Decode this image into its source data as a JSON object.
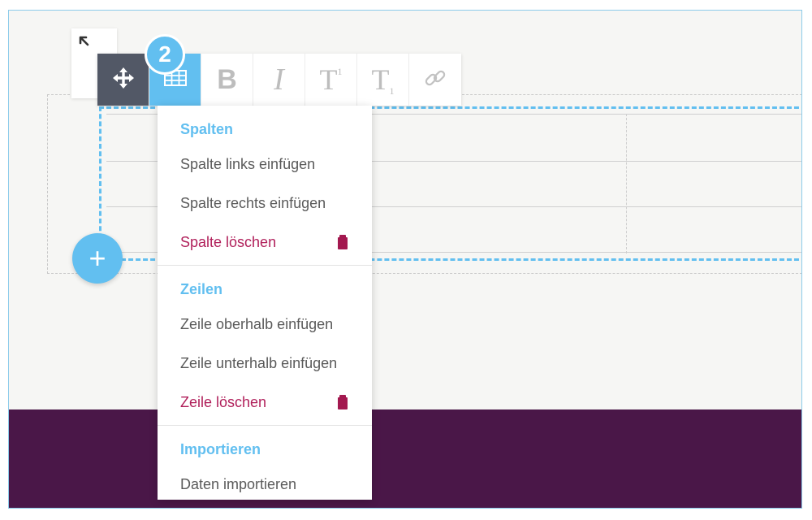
{
  "step_badge": "2",
  "toolbar": {
    "resize_icon": "arrow-up-left-icon",
    "buttons": [
      {
        "name": "move",
        "icon": "move-icon"
      },
      {
        "name": "table",
        "icon": "table-icon"
      },
      {
        "name": "bold",
        "label": "B"
      },
      {
        "name": "italic",
        "label": "I"
      },
      {
        "name": "superscript",
        "label": "T",
        "suffix": "1"
      },
      {
        "name": "subscript",
        "label": "T",
        "suffix": "1"
      },
      {
        "name": "link",
        "icon": "link-icon"
      }
    ]
  },
  "add_button": {
    "icon": "plus-icon",
    "label": "+"
  },
  "dropdown": {
    "sections": [
      {
        "header": "Spalten",
        "items": [
          {
            "label": "Spalte links einfügen"
          },
          {
            "label": "Spalte rechts einfügen"
          },
          {
            "label": "Spalte löschen",
            "danger": true,
            "icon": "trash-icon"
          }
        ]
      },
      {
        "header": "Zeilen",
        "items": [
          {
            "label": "Zeile oberhalb einfügen"
          },
          {
            "label": "Zeile unterhalb einfügen"
          },
          {
            "label": "Zeile löschen",
            "danger": true,
            "icon": "trash-icon"
          }
        ]
      },
      {
        "header": "Importieren",
        "items": [
          {
            "label": "Daten importieren"
          }
        ]
      }
    ]
  },
  "colors": {
    "accent": "#62bff0",
    "danger": "#b01f5a",
    "footer": "#4a1748",
    "move_button": "#525866"
  }
}
